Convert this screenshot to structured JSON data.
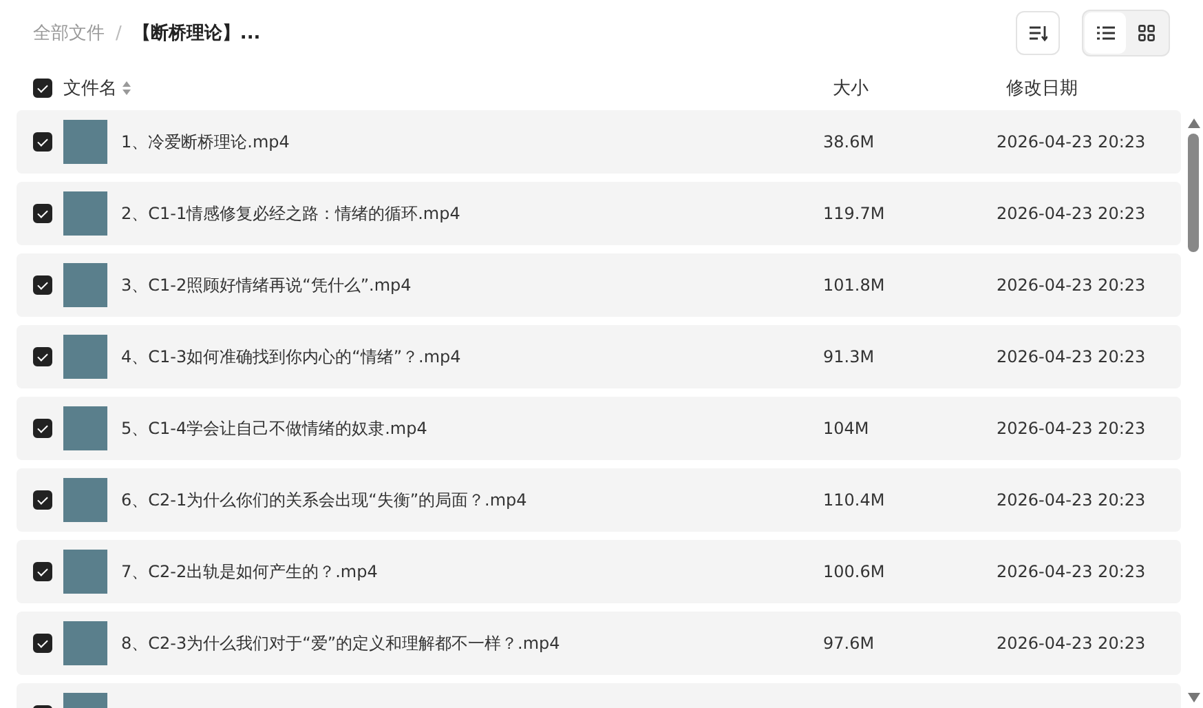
{
  "breadcrumb_separator": "/",
  "breadcrumb": [
    {
      "label": "全部文件",
      "current": false
    },
    {
      "label": "【断桥理论】...",
      "current": true
    }
  ],
  "view_toggle": [
    {
      "kind": "list",
      "selected": true
    },
    {
      "kind": "grid",
      "selected": false
    }
  ],
  "header": {
    "checked": true,
    "columns": [
      "文件名",
      "大小",
      "修改日期"
    ]
  },
  "rows": [
    {
      "checked": true,
      "name": "1、冷爱断桥理论.mp4",
      "size": "38.6M",
      "date": "2026-04-23 20:23"
    },
    {
      "checked": true,
      "name": "2、C1-1情感修复必经之路：情绪的循环.mp4",
      "size": "119.7M",
      "date": "2026-04-23 20:23"
    },
    {
      "checked": true,
      "name": "3、C1-2照顾好情绪再说“凭什么”.mp4",
      "size": "101.8M",
      "date": "2026-04-23 20:23"
    },
    {
      "checked": true,
      "name": "4、C1-3如何准确找到你内心的“情绪”？.mp4",
      "size": "91.3M",
      "date": "2026-04-23 20:23"
    },
    {
      "checked": true,
      "name": "5、C1-4学会让自己不做情绪的奴隶.mp4",
      "size": "104M",
      "date": "2026-04-23 20:23"
    },
    {
      "checked": true,
      "name": "6、C2-1为什么你们的关系会出现“失衡”的局面？.mp4",
      "size": "110.4M",
      "date": "2026-04-23 20:23"
    },
    {
      "checked": true,
      "name": "7、C2-2出轨是如何产生的？.mp4",
      "size": "100.6M",
      "date": "2026-04-23 20:23"
    },
    {
      "checked": true,
      "name": "8、C2-3为什么我们对于“爱”的定义和理解都不一样？.mp4",
      "size": "97.6M",
      "date": "2026-04-23 20:23"
    },
    {
      "checked": true
    }
  ]
}
